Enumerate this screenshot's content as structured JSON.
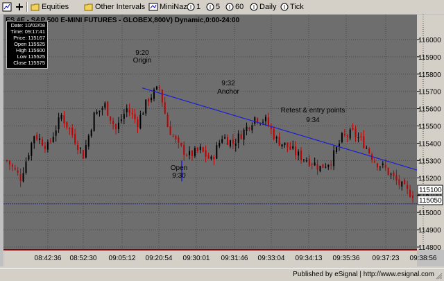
{
  "toolbar": {
    "items": [
      {
        "label": "",
        "icon": "new-chart-icon"
      },
      {
        "label": "",
        "icon": "add-icon"
      },
      {
        "label": "Equities",
        "icon": "folder-icon"
      },
      {
        "label": "Other Intervals",
        "icon": "folder-icon"
      },
      {
        "label": "MiniNaz",
        "icon": "chart-link-icon"
      },
      {
        "label": "1",
        "icon": "interval-icon"
      },
      {
        "label": "5",
        "icon": "interval-icon"
      },
      {
        "label": "60",
        "icon": "interval-icon"
      },
      {
        "label": "Daily",
        "icon": "interval-icon"
      },
      {
        "label": "Tick",
        "icon": "interval-icon"
      }
    ]
  },
  "chart": {
    "title": "ES #F - S&P 500 E-MINI FUTURES - GLOBEX,800V) Dynamic,0:00-24:00",
    "background": "#6e6e6e",
    "candle_color_up": "#000000",
    "candle_color_down": "#c00000",
    "trendline_color": "#1c1cd6",
    "support_line_color": "#1c1cd6",
    "ylim": [
      114800,
      116100
    ],
    "y_ticks": [
      "116000",
      "115900",
      "115800",
      "115700",
      "115600",
      "115500",
      "115400",
      "115300",
      "115200",
      "115100",
      "115000",
      "114900",
      "114800"
    ],
    "x_ticks": [
      "08:42:36",
      "08:52:30",
      "09:05:12",
      "09:20:54",
      "09:30:01",
      "09:31:46",
      "09:33:04",
      "09:34:13",
      "09:35:36",
      "09:37:23",
      "09:38:56"
    ],
    "price_badges": [
      {
        "value": "115100"
      },
      {
        "value": "115050"
      }
    ],
    "support_level": 115050,
    "annotations": [
      {
        "line1": "9:20",
        "line2": "Origin"
      },
      {
        "line1": "9:32",
        "line2": "Anchor"
      },
      {
        "line1": "Retest & entry points",
        "line2": "9:34"
      },
      {
        "line1": "Open",
        "line2": "9:30"
      }
    ]
  },
  "infobox": {
    "lines": [
      "Date: 10/02/08",
      "Time: 09:17:41",
      "Price: 115167",
      "Open 115525",
      "High 115600",
      "Low 115525",
      "Close 115575"
    ]
  },
  "footer": {
    "text": "Published by eSignal | http://www.esignal.com"
  }
}
